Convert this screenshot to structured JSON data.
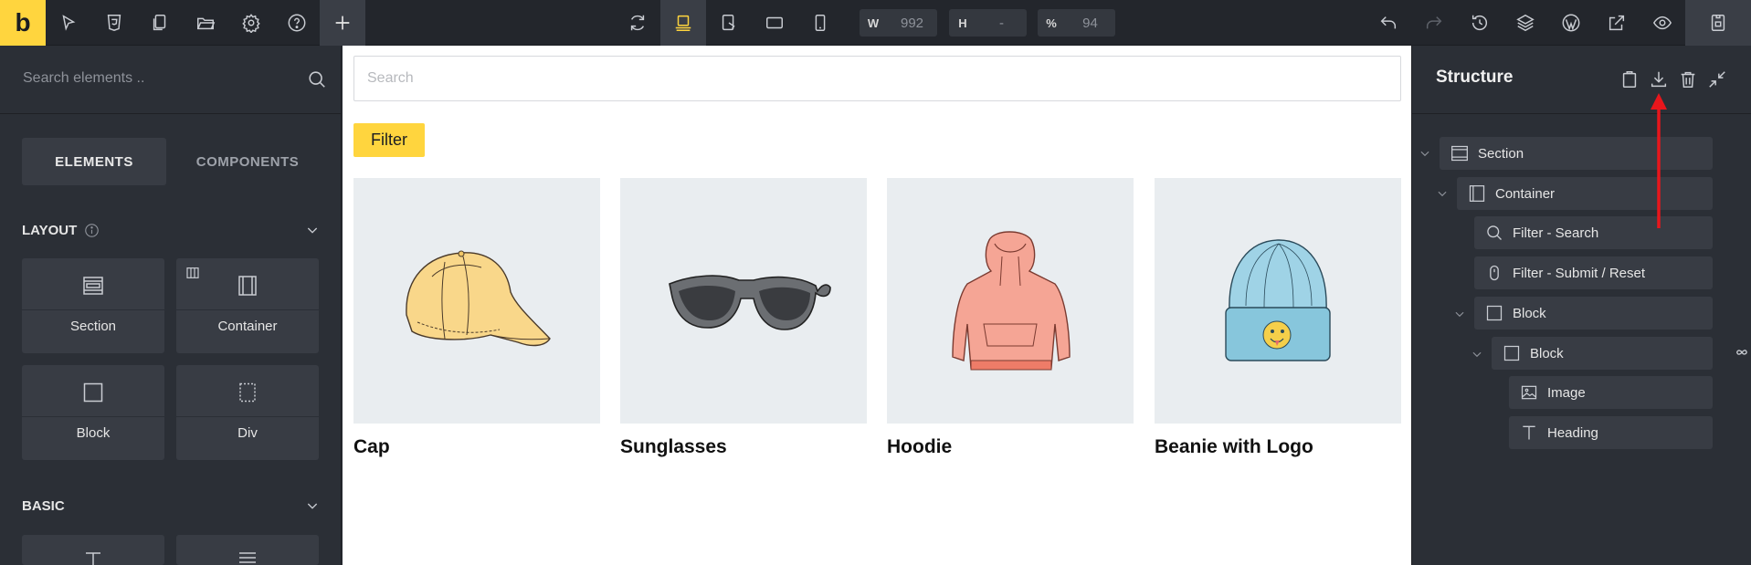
{
  "toolbar": {
    "logo": "b",
    "width_label": "W",
    "width_value": "992",
    "height_label": "H",
    "height_value": "-",
    "zoom_label": "%",
    "zoom_value": "94"
  },
  "left_panel": {
    "search_placeholder": "Search elements ..",
    "tabs": [
      {
        "label": "ELEMENTS",
        "active": true
      },
      {
        "label": "COMPONENTS",
        "active": false
      }
    ],
    "categories": [
      {
        "title": "LAYOUT",
        "elements": [
          "Section",
          "Container",
          "Block",
          "Div"
        ]
      },
      {
        "title": "BASIC",
        "elements": []
      }
    ]
  },
  "canvas": {
    "search_placeholder": "Search",
    "filter_label": "Filter",
    "products": [
      {
        "name": "Cap",
        "icon": "cap-image"
      },
      {
        "name": "Sunglasses",
        "icon": "sunglasses-image"
      },
      {
        "name": "Hoodie",
        "icon": "hoodie-image"
      },
      {
        "name": "Beanie with Logo",
        "icon": "beanie-image"
      }
    ]
  },
  "structure": {
    "title": "Structure",
    "nodes": [
      {
        "label": "Section",
        "icon": "section-icon"
      },
      {
        "label": "Container",
        "icon": "container-icon"
      },
      {
        "label": "Filter - Search",
        "icon": "search-icon"
      },
      {
        "label": "Filter - Submit / Reset",
        "icon": "mouse-icon"
      },
      {
        "label": "Block",
        "icon": "block-icon"
      },
      {
        "label": "Block",
        "icon": "block-icon"
      },
      {
        "label": "Image",
        "icon": "image-icon"
      },
      {
        "label": "Heading",
        "icon": "heading-icon"
      }
    ]
  },
  "colors": {
    "accent": "#ffd53e",
    "annotation_arrow": "#e8161c"
  }
}
